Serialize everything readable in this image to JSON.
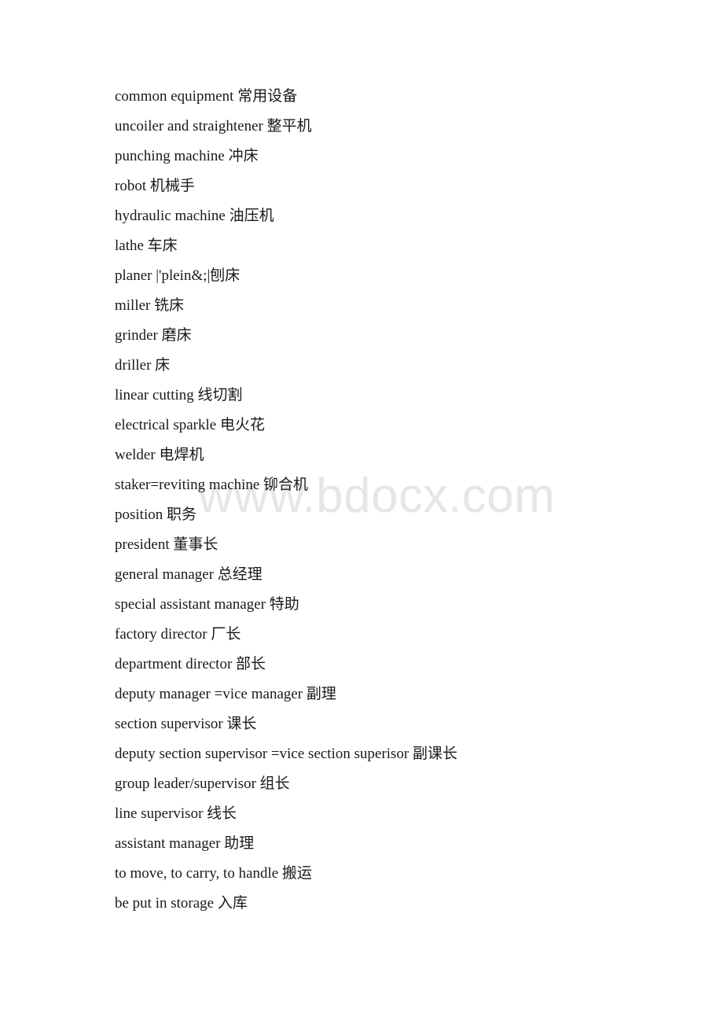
{
  "document": {
    "type": "text-page",
    "background_color": "#ffffff",
    "text_color": "#1a1a1a"
  },
  "watermark": {
    "text": "www.bdocx.com",
    "color": "#e6e6e6"
  },
  "glossary": {
    "lines": [
      {
        "text": "common equipment 常用设备"
      },
      {
        "text": "uncoiler and straightener 整平机"
      },
      {
        "text": "punching machine 冲床"
      },
      {
        "text": "robot 机械手"
      },
      {
        "text": "hydraulic machine 油压机"
      },
      {
        "text": "lathe 车床"
      },
      {
        "text": "planer |'plein&;|刨床"
      },
      {
        "text": "miller 铣床"
      },
      {
        "text": "grinder 磨床"
      },
      {
        "text": "driller 床"
      },
      {
        "text": "linear cutting 线切割"
      },
      {
        "text": "electrical sparkle 电火花"
      },
      {
        "text": "welder 电焊机"
      },
      {
        "text": "staker=reviting machine 铆合机"
      },
      {
        "text": "position 职务"
      },
      {
        "text": "president 董事长"
      },
      {
        "text": "general manager 总经理"
      },
      {
        "text": "special assistant manager 特助"
      },
      {
        "text": "factory director 厂长"
      },
      {
        "text": "department director 部长"
      },
      {
        "text": "deputy manager =vice manager 副理"
      },
      {
        "text": "section supervisor 课长"
      },
      {
        "text": "deputy section supervisor =vice section superisor 副课长"
      },
      {
        "text": "group leader/supervisor 组长"
      },
      {
        "text": "line supervisor 线长"
      },
      {
        "text": "assistant manager 助理"
      },
      {
        "text": "to move, to carry, to handle 搬运"
      },
      {
        "text": "be put in storage 入库"
      }
    ]
  }
}
